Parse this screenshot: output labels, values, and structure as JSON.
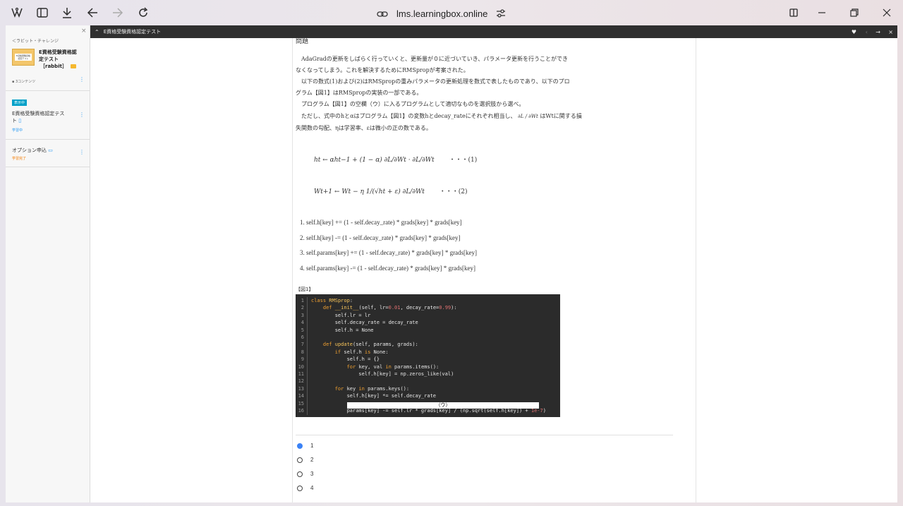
{
  "browser": {
    "url": "lms.learningbox.online"
  },
  "sidebar": {
    "back_link": "＜ラビット・チャレンジ",
    "course_title_line1": "E資格受験資格認",
    "course_title_line2": "定テスト",
    "course_title_line3": "［rabbit］",
    "thumb_text": "E資格受験資格認定テスト",
    "contents_count": "3コンテンツ",
    "items": [
      {
        "badge": "表示中",
        "title_line1": "E資格受験資格認定テス",
        "title_line2": "ト",
        "status": "学習中",
        "status_color": "#2196f3"
      },
      {
        "badge": "",
        "title_line1": "オプション申込",
        "title_line2": "",
        "status": "学習完了",
        "status_color": "#f57c00"
      }
    ]
  },
  "topbar": {
    "title": "E資格受験資格認定テスト"
  },
  "question": {
    "heading": "問題",
    "p1a": "　AdaGradの更新をしばらく行っていくと、更新量が０に近づいていき、パラメータ更新を行うことができ",
    "p1b": "なくなってしまう。これを解決するためにRMSpropが考案された。",
    "p2a": "　以下の数式(1)および(2)はRMSpropの重みパラメータの更新処理を数式で表したものであり、以下のプロ",
    "p2b": "グラム【図1】はRMSpropの実装の一部である。",
    "p3": "　プログラム【図1】の空欄（ウ）に入るプログラムとして適切なものを選択肢から選べ。",
    "p4a": "　ただし、式中のhとαはプログラム【図1】の変数hとdecay_rateにそれぞれ相当し、",
    "p4a_tail": "はWtに関する損",
    "p4b": "失関数の勾配、ηは学習率、εは微小の正の数である。",
    "partial": "∂L / ∂Wt",
    "eq1": "ht ← αht−1 + (1 − α) ∂L/∂Wt · ∂L/∂Wt",
    "eq1_no": "・・・(1)",
    "eq2": "Wt+1 ← Wt − η 1/(√ht + ε) ∂L/∂Wt",
    "eq2_no": "・・・(2)",
    "choices": [
      "1.  self.h[key] += (1 - self.decay_rate) * grads[key] * grads[key]",
      "2.  self.h[key] -= (1 - self.decay_rate) * grads[key] * grads[key]",
      "3.  self.params[key] += (1 - self.decay_rate) * grads[key] * grads[key]",
      "4.  self.params[key] -= (1 - self.decay_rate) * grads[key] * grads[key]"
    ],
    "fig_label": "【図1】",
    "blank_label": "（ウ）",
    "answers": [
      "1",
      "2",
      "3",
      "4"
    ],
    "selected_answer": "1"
  },
  "colors": {
    "badge": "#00a0c8",
    "radio_selected": "#3b82f6",
    "topbar": "#2f2f2f"
  }
}
